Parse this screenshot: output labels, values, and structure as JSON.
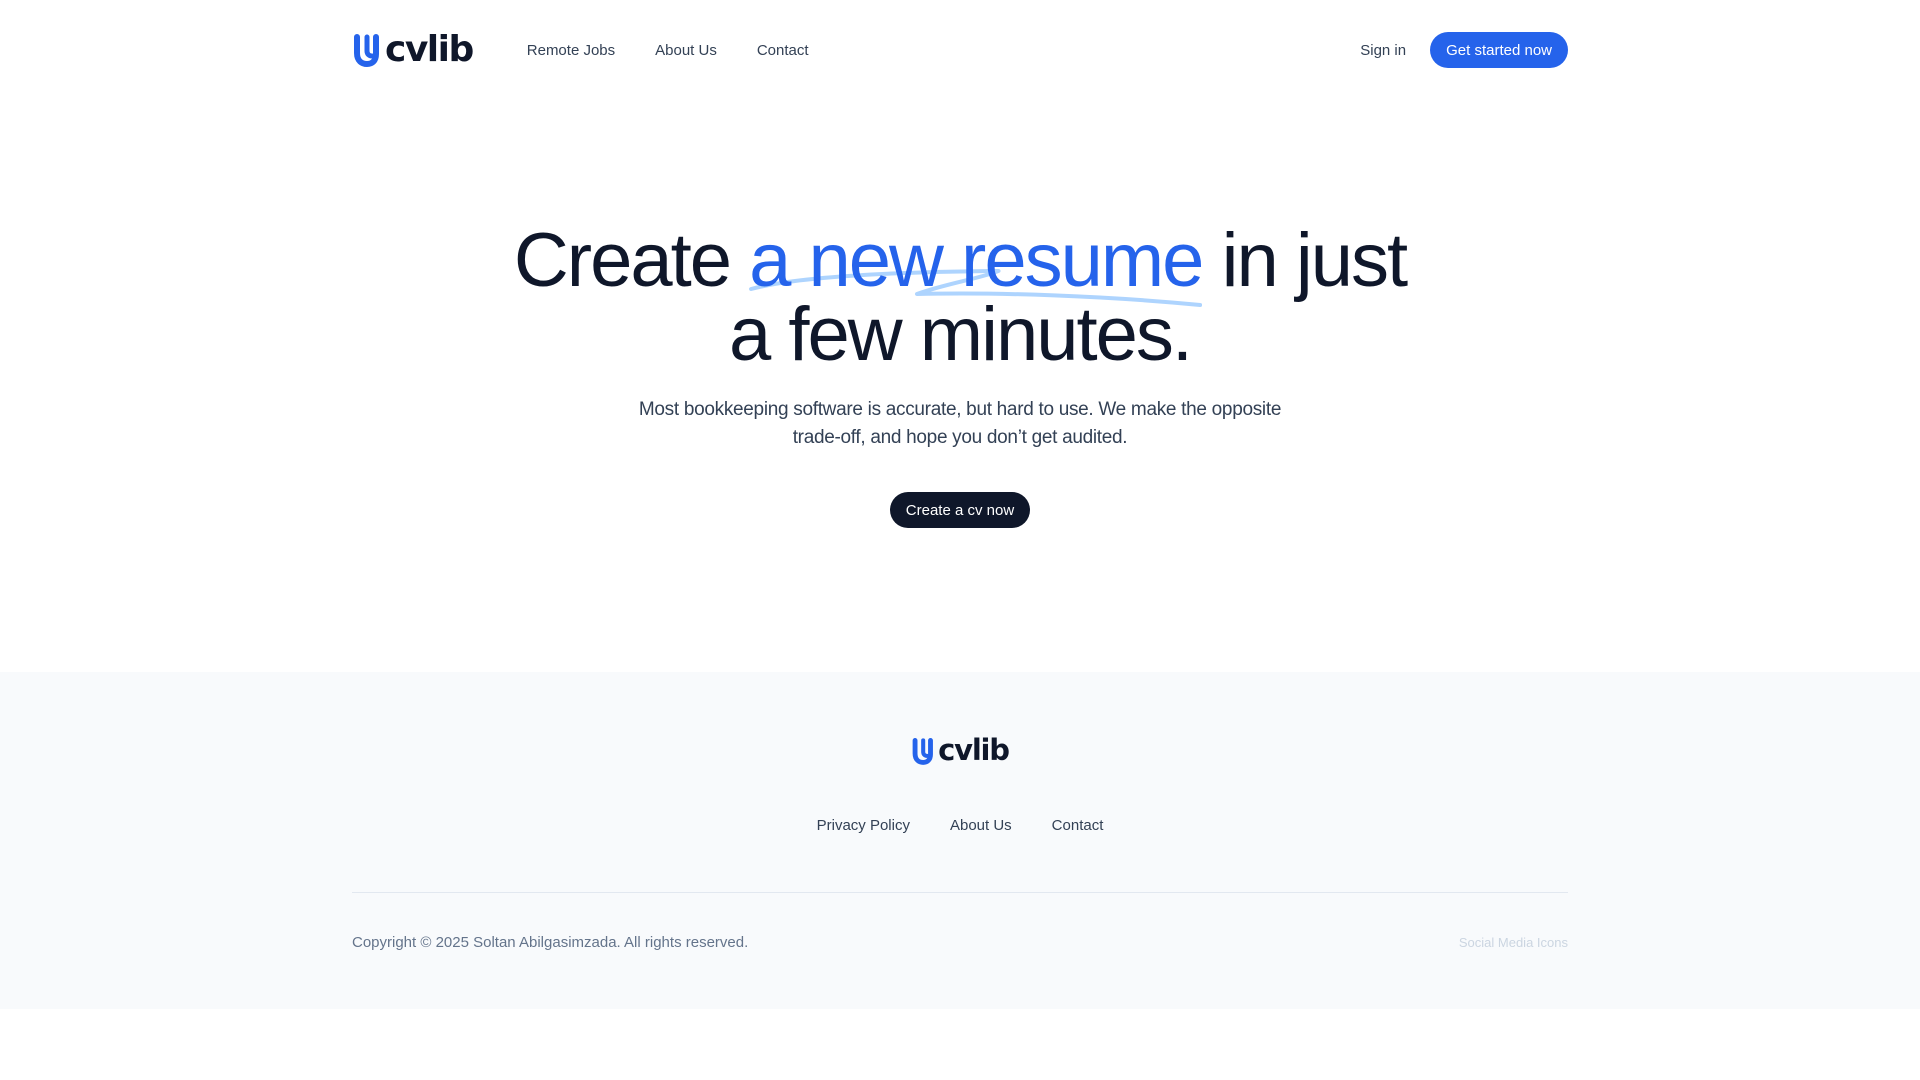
{
  "header": {
    "logo_text": "cvlib",
    "nav": [
      {
        "label": "Remote Jobs"
      },
      {
        "label": "About Us"
      },
      {
        "label": "Contact"
      }
    ],
    "signin_label": "Sign in",
    "cta_label": "Get started now"
  },
  "hero": {
    "title_before": "Create ",
    "title_highlight": "a new resume",
    "title_after_line1": " in just",
    "title_line2": "a few minutes.",
    "subtitle": "Most bookkeeping software is accurate, but hard to use. We make the opposite trade-off, and hope you don’t get audited.",
    "cta_label": "Create a cv now"
  },
  "footer": {
    "logo_text": "cvlib",
    "nav": [
      {
        "label": "Privacy Policy"
      },
      {
        "label": "About Us"
      },
      {
        "label": "Contact"
      }
    ],
    "copyright": "Copyright © 2025 Soltan Abilgasimzada. All rights reserved.",
    "social_placeholder": "Social Media Icons"
  },
  "colors": {
    "brand": "#2563eb",
    "dark": "#0f172a",
    "text": "#334155",
    "muted": "#64748b",
    "footer_bg": "#f8fafc"
  },
  "icons": {
    "logo_mark": "cvlib-u-logo-icon",
    "scribble": "scribble-underline-icon"
  }
}
